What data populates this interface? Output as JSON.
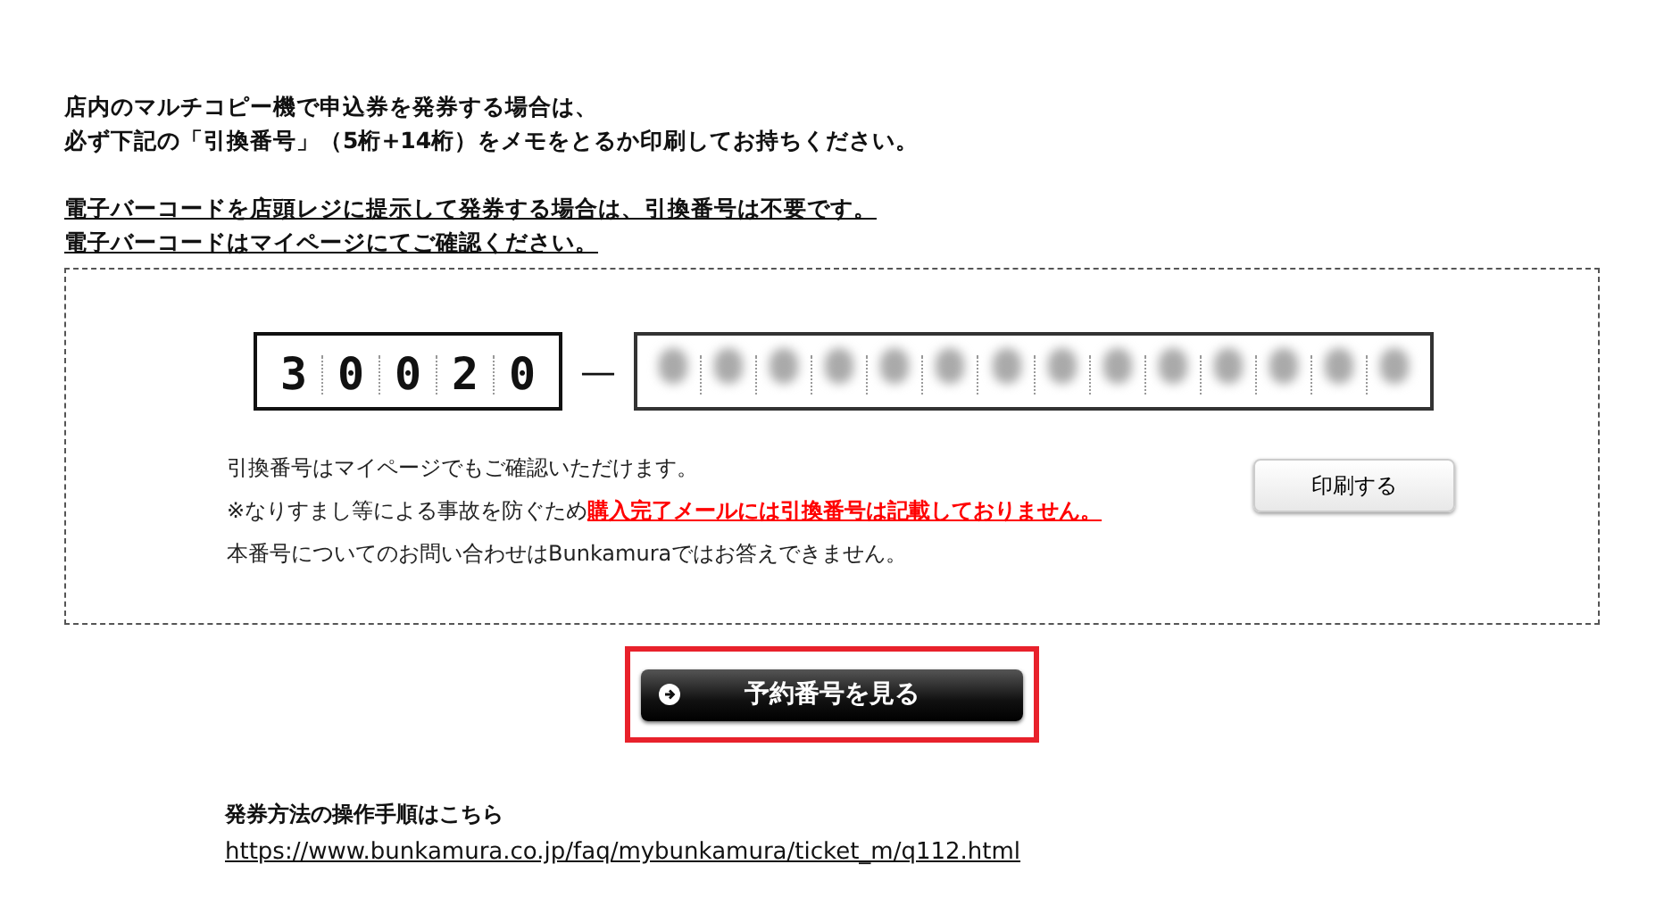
{
  "notice": {
    "lines": [
      "店内のマルチコピー機で申込券を発券する場合は、",
      "必ず下記の「引換番号」（5桁+14桁）をメモをとるか印刷してお持ちください。"
    ],
    "underlined_lines": [
      "電子バーコードを店頭レジに提示して発券する場合は、引換番号は不要です。",
      "電子バーコードはマイページにてご確認ください。"
    ]
  },
  "code": {
    "first_digits": [
      "3",
      "0",
      "0",
      "2",
      "0"
    ],
    "separator": "—",
    "second_part": {
      "kind": "blurred"
    }
  },
  "info": [
    {
      "text": "引換番号はマイページでもご確認いただけます。"
    },
    {
      "text": "※なりすまし等による事故を防ぐため",
      "warning": "購入完了メールには引換番号は記載しておりません。"
    },
    {
      "text": "本番号についてのお問い合わせはBunkamuraではお答えできません。"
    }
  ],
  "print_button": "印刷する",
  "view_button": {
    "label": "予約番号を見る",
    "highlighted": true
  },
  "guide": {
    "heading": "発券方法の操作手順はこちら",
    "link": "https://www.bunkamura.co.jp/faq/mybunkamura/ticket_m/q112.html"
  }
}
